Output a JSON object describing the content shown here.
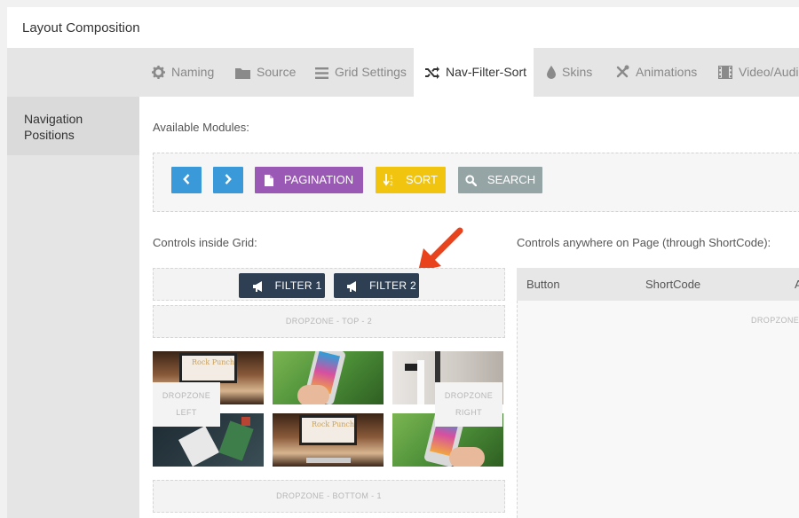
{
  "panel": {
    "title": "Layout Composition"
  },
  "tabs": [
    {
      "label": "Naming",
      "icon": "gear-icon"
    },
    {
      "label": "Source",
      "icon": "folder-icon"
    },
    {
      "label": "Grid Settings",
      "icon": "list-icon"
    },
    {
      "label": "Nav-Filter-Sort",
      "icon": "shuffle-icon",
      "active": true
    },
    {
      "label": "Skins",
      "icon": "droplet-icon"
    },
    {
      "label": "Animations",
      "icon": "tools-icon"
    },
    {
      "label": "Video/Audi",
      "icon": "film-icon"
    }
  ],
  "sidebar": {
    "items": [
      {
        "label_line1": "Navigation",
        "label_line2": "Positions"
      }
    ]
  },
  "modules": {
    "label": "Available Modules:",
    "pagination": "PAGINATION",
    "sort": "SORT",
    "search": "SEARCH",
    "colors": {
      "nav": "#3a9ad9",
      "pagination": "#9b59b6",
      "sort": "#f1c40f",
      "search": "#95a5a6"
    }
  },
  "grid": {
    "label": "Controls inside Grid:",
    "filter1": "FILTER 1",
    "filter2": "FILTER 2",
    "top2": "DROPZONE - TOP - 2",
    "left_line1": "DROPZONE",
    "left_line2": "LEFT",
    "right_line1": "DROPZONE",
    "right_line2": "RIGHT",
    "bottom1": "DROPZONE - BOTTOM - 1",
    "thumb_logo": "Rock Punch"
  },
  "shortcode": {
    "label": "Controls anywhere on Page (through ShortCode):",
    "col_button": "Button",
    "col_shortcode": "ShortCode",
    "col_a": "A",
    "dropzone": "DROPZONE"
  },
  "arrow_color": "#e8431c"
}
